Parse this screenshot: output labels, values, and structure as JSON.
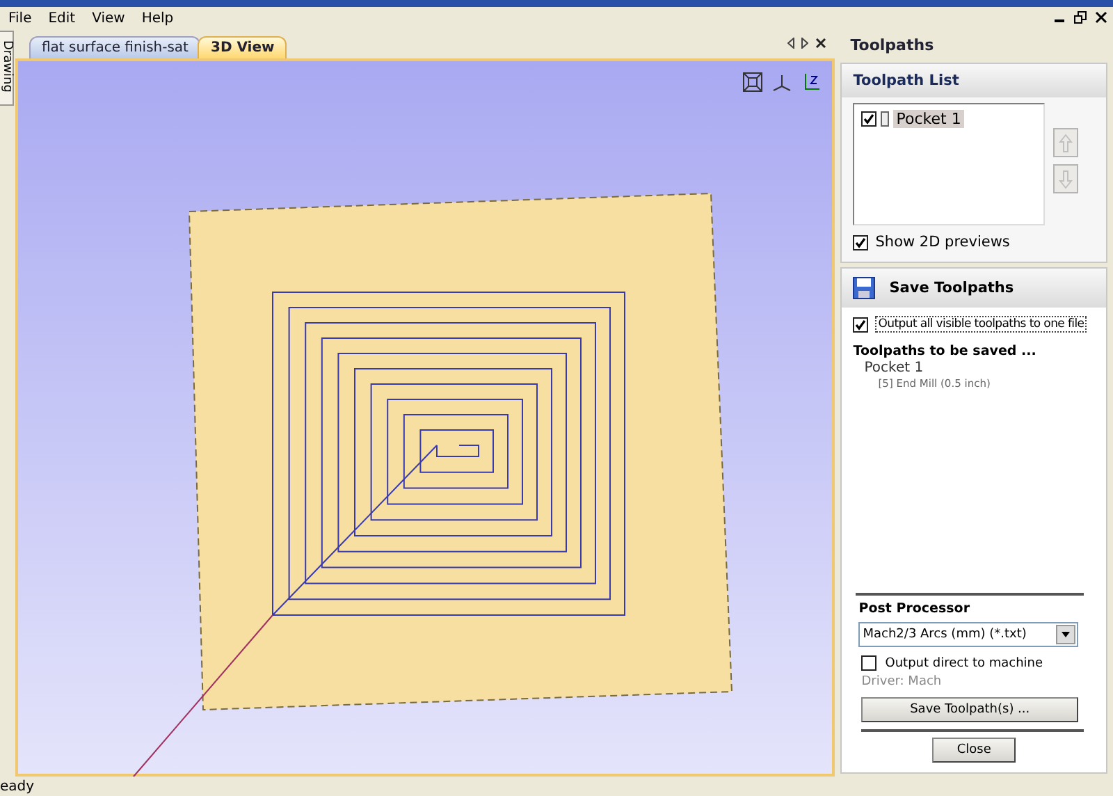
{
  "menu": [
    "File",
    "Edit",
    "View",
    "Help"
  ],
  "side_tabs": [
    {
      "label": "Drawing"
    }
  ],
  "doc_tabs": [
    {
      "label": "flat surface finish-sat",
      "selected": false
    },
    {
      "label": "3D View",
      "selected": true
    }
  ],
  "panel": {
    "title": "Toolpaths"
  },
  "toolpath_list": {
    "title": "Toolpath List",
    "items": [
      {
        "label": "Pocket 1",
        "checked": true,
        "selected": true
      }
    ],
    "move_buttons": [
      {
        "kind": "up",
        "disabled": true
      },
      {
        "kind": "down",
        "disabled": true
      }
    ],
    "show_2d_previews": {
      "label": "Show 2D previews",
      "checked": true
    }
  },
  "save_toolpaths": {
    "title": "Save Toolpaths",
    "output_all": {
      "label": "Output all visible toolpaths to one file",
      "checked": true
    },
    "to_be_saved_heading": "Toolpaths to be saved ...",
    "items": [
      {
        "name": "Pocket 1",
        "tool": "[5] End Mill (0.5 inch)"
      }
    ],
    "post_processor": {
      "heading": "Post Processor",
      "value": "Mach2/3 Arcs (mm) (*.txt)"
    },
    "output_direct": {
      "label": "Output direct to machine",
      "checked": false
    },
    "driver": "Driver: Mach",
    "save_button": "Save Toolpath(s) ...",
    "close_button": "Close"
  },
  "status_bar": {
    "text": "eady"
  }
}
